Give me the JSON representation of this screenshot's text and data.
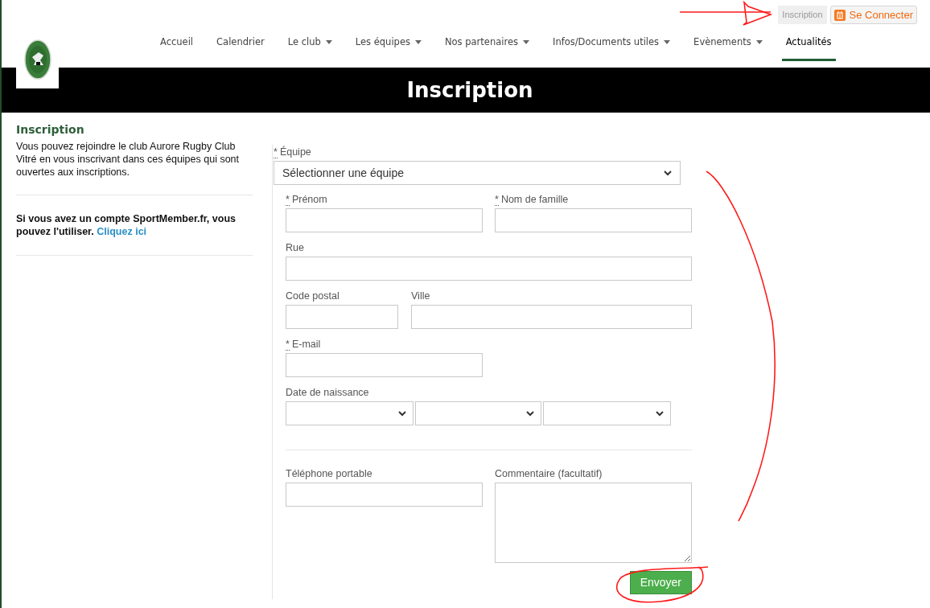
{
  "top_links": [
    {
      "label": "Inscription",
      "kind": "plain"
    },
    {
      "label": "Se Connecter",
      "kind": "login"
    }
  ],
  "nav": [
    {
      "label": "Accueil",
      "dropdown": false,
      "selected": false
    },
    {
      "label": "Calendrier",
      "dropdown": false,
      "selected": false
    },
    {
      "label": "Le club",
      "dropdown": true,
      "selected": false
    },
    {
      "label": "Les équipes",
      "dropdown": true,
      "selected": false
    },
    {
      "label": "Nos partenaires",
      "dropdown": true,
      "selected": false
    },
    {
      "label": "Infos/Documents utiles",
      "dropdown": true,
      "selected": false
    },
    {
      "label": "Evènements",
      "dropdown": true,
      "selected": false
    },
    {
      "label": "Actualités",
      "dropdown": false,
      "selected": true
    }
  ],
  "banner": {
    "title": "Inscription"
  },
  "sidebar": {
    "heading": "Inscription",
    "text": "Vous pouvez rejoindre le club Aurore Rugby Club Vitré en vous inscrivant dans ces équipes qui sont ouvertes aux inscriptions.",
    "account_text": "Si vous avez un compte SportMember.fr, vous pouvez l'utiliser.",
    "account_link": "Cliquez ici"
  },
  "form": {
    "required_mark": "*",
    "team": {
      "label": "Équipe",
      "required": true,
      "value": "Sélectionner une équipe"
    },
    "rows": [
      [
        {
          "label": "Prénom",
          "required": true,
          "kind": "text"
        },
        {
          "label": "Nom de famille",
          "required": true,
          "kind": "text"
        }
      ],
      [
        {
          "label": "Rue",
          "required": false,
          "kind": "text"
        }
      ],
      [
        {
          "label": "Code postal",
          "required": false,
          "kind": "text"
        },
        {
          "label": "Ville",
          "required": false,
          "kind": "text"
        }
      ],
      [
        {
          "label": "E-mail",
          "required": true,
          "kind": "text"
        }
      ],
      [
        {
          "label": "Date de naissance",
          "required": false,
          "kind": "date"
        }
      ],
      [
        {
          "label": "Téléphone portable",
          "required": false,
          "kind": "text"
        },
        {
          "label": "Commentaire (facultatif)",
          "required": false,
          "kind": "textarea"
        }
      ]
    ],
    "submit": "Envoyer"
  }
}
